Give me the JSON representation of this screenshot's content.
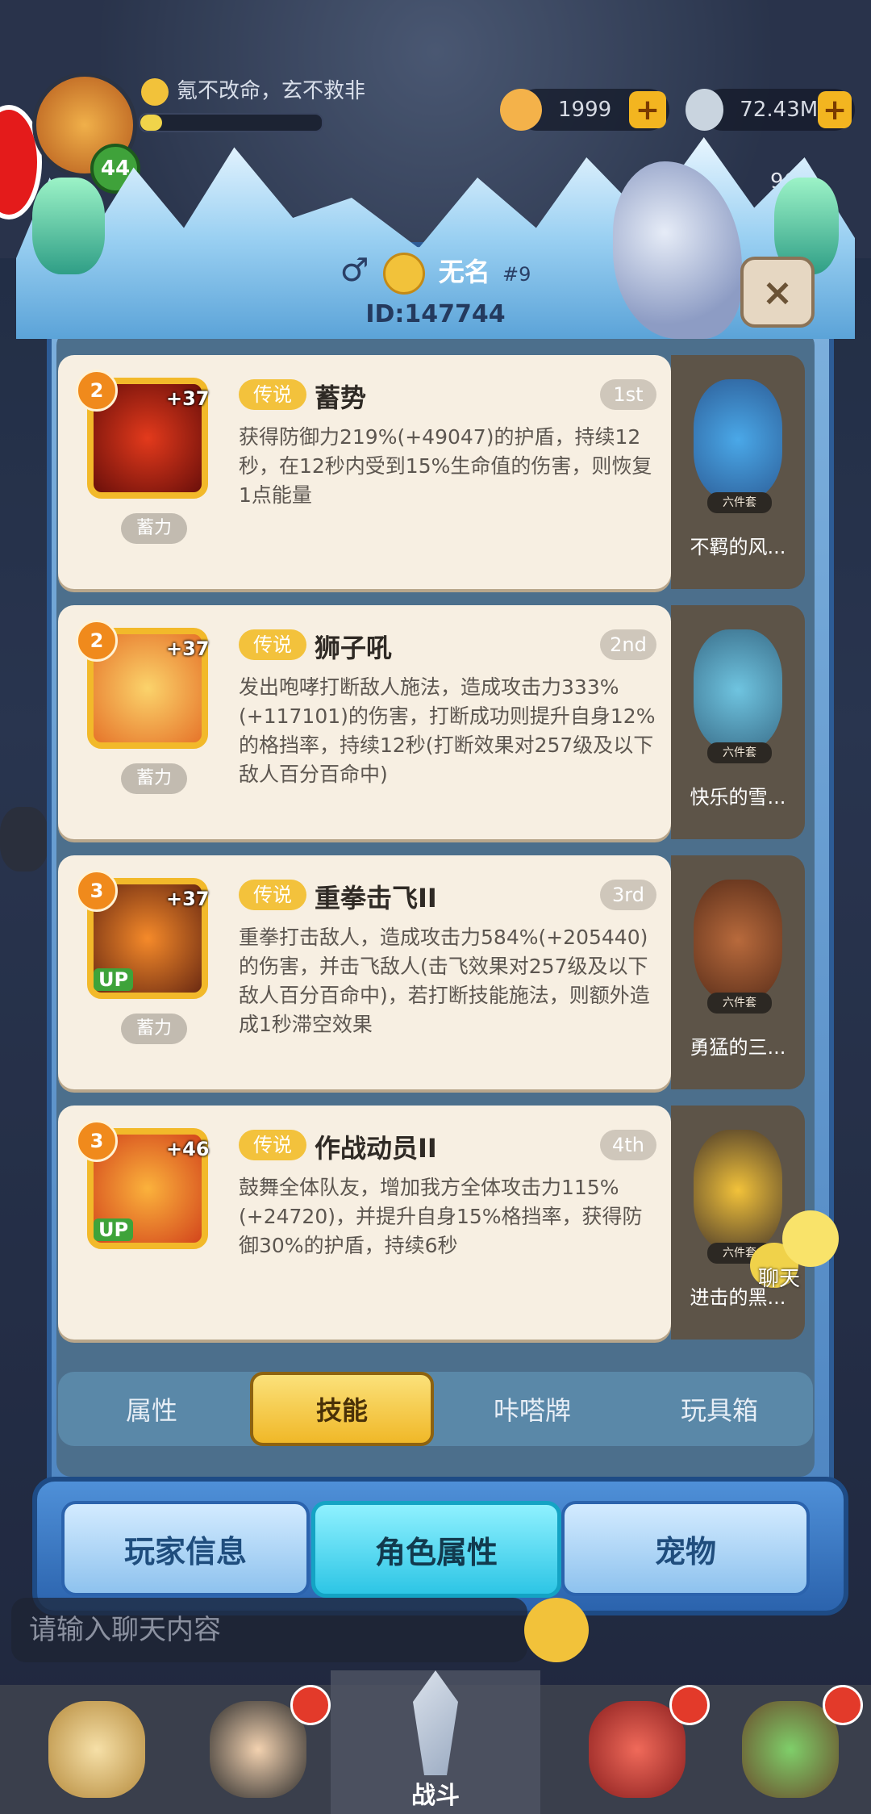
{
  "header": {
    "motto": "氪不改命，玄不救非",
    "level": "44",
    "resources": [
      {
        "icon": "shell-icon",
        "value": "1999"
      },
      {
        "icon": "cloud-coin-icon",
        "value": "72.43M"
      }
    ],
    "xp_progress": 0.12,
    "partial_number": "96"
  },
  "profile": {
    "gender_symbol": "♂",
    "name": "无名",
    "rank": "#9",
    "id": "ID:147744",
    "close_symbol": "×"
  },
  "skills": [
    {
      "level": "2",
      "bonus": "+37",
      "up": "",
      "charge": "蓄力",
      "tag": "传说",
      "name": "蓄势",
      "rank": "1st",
      "desc": "获得防御力219%(+49047)的护盾，持续12秒，在12秒内受到15%生命值的伤害，则恢复1点能量",
      "pet_tag": "六件套",
      "pet_name": "不羁的风..."
    },
    {
      "level": "2",
      "bonus": "+37",
      "up": "",
      "charge": "蓄力",
      "tag": "传说",
      "name": "狮子吼",
      "rank": "2nd",
      "desc": "发出咆哮打断敌人施法，造成攻击力333%(+117101)的伤害，打断成功则提升自身12%的格挡率，持续12秒(打断效果对257级及以下敌人百分百命中)",
      "pet_tag": "六件套",
      "pet_name": "快乐的雪..."
    },
    {
      "level": "3",
      "bonus": "+37",
      "up": "UP",
      "charge": "蓄力",
      "tag": "传说",
      "name": "重拳击飞II",
      "rank": "3rd",
      "desc": "重拳打击敌人，造成攻击力584%(+205440)的伤害，并击飞敌人(击飞效果对257级及以下敌人百分百命中)，若打断技能施法，则额外造成1秒滞空效果",
      "pet_tag": "六件套",
      "pet_name": "勇猛的三..."
    },
    {
      "level": "3",
      "bonus": "+46",
      "up": "UP",
      "charge": "",
      "tag": "传说",
      "name": "作战动员II",
      "rank": "4th",
      "desc": "鼓舞全体队友，增加我方全体攻击力115%(+24720)，并提升自身15%格挡率，获得防御30%的护盾，持续6秒",
      "pet_tag": "六件套",
      "pet_name": "进击的黑..."
    }
  ],
  "subtabs": [
    "属性",
    "技能",
    "咔嗒牌",
    "玩具箱"
  ],
  "maintabs": [
    "玩家信息",
    "角色属性",
    "宠物"
  ],
  "chat": {
    "placeholder": "请输入聊天内容",
    "float_label": "聊天"
  },
  "bottom_nav": {
    "battle_label": "战斗"
  }
}
